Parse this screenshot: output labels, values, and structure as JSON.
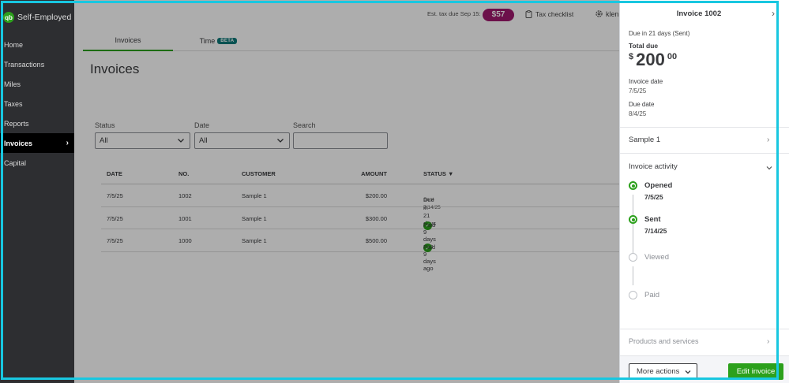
{
  "app": {
    "brand": "Self-Employed",
    "logo_text": "qb"
  },
  "sidebar": {
    "items": [
      {
        "label": "Home"
      },
      {
        "label": "Transactions"
      },
      {
        "label": "Miles"
      },
      {
        "label": "Taxes"
      },
      {
        "label": "Reports"
      },
      {
        "label": "Invoices",
        "active": true
      },
      {
        "label": "Capital"
      }
    ]
  },
  "topbar": {
    "est_tax_label": "Est. tax due Sep 15:",
    "est_tax_amount": "$57",
    "tax_checklist": "Tax checklist",
    "user_partial": "klen"
  },
  "tabs": [
    {
      "label": "Invoices",
      "active": true
    },
    {
      "label": "Time",
      "badge": "BETA"
    }
  ],
  "page": {
    "title": "Invoices"
  },
  "filters": {
    "status": {
      "label": "Status",
      "value": "All"
    },
    "date": {
      "label": "Date",
      "value": "All"
    },
    "search": {
      "label": "Search",
      "value": ""
    }
  },
  "table": {
    "headers": {
      "date": "DATE",
      "no": "NO.",
      "customer": "CUSTOMER",
      "amount": "AMOUNT",
      "status": "STATUS ▼"
    },
    "rows": [
      {
        "date": "7/5/25",
        "no": "1002",
        "customer": "Sample 1",
        "amount": "$200.00",
        "status": "Due in 21 days",
        "status_sub": "Sent 7/14/25"
      },
      {
        "date": "7/5/25",
        "no": "1001",
        "customer": "Sample 1",
        "amount": "$300.00",
        "status": "Paid 9 days ago"
      },
      {
        "date": "7/5/25",
        "no": "1000",
        "customer": "Sample 1",
        "amount": "$500.00",
        "status": "Paid 9 days ago"
      }
    ]
  },
  "panel": {
    "title": "Invoice 1002",
    "due_in": "Due in 21 days (Sent)",
    "total_due_label": "Total due",
    "total_currency": "$",
    "total_whole": "200",
    "total_cents": "00",
    "invoice_date_label": "Invoice date",
    "invoice_date": "7/5/25",
    "due_date_label": "Due date",
    "due_date": "8/4/25",
    "customer": "Sample 1",
    "activity_title": "Invoice activity",
    "activity": [
      {
        "label": "Opened",
        "date": "7/5/25",
        "done": true
      },
      {
        "label": "Sent",
        "date": "7/14/25",
        "done": true
      },
      {
        "label": "Viewed",
        "date": "",
        "done": false
      },
      {
        "label": "Paid",
        "date": "",
        "done": false
      }
    ],
    "products_label": "Products and services",
    "more_actions": "More actions",
    "edit_invoice": "Edit invoice"
  },
  "colors": {
    "brand_green": "#2ca01c",
    "tax_pill": "#a0196e",
    "beta_badge": "#0d7a7a",
    "frame": "#18c7e0"
  }
}
